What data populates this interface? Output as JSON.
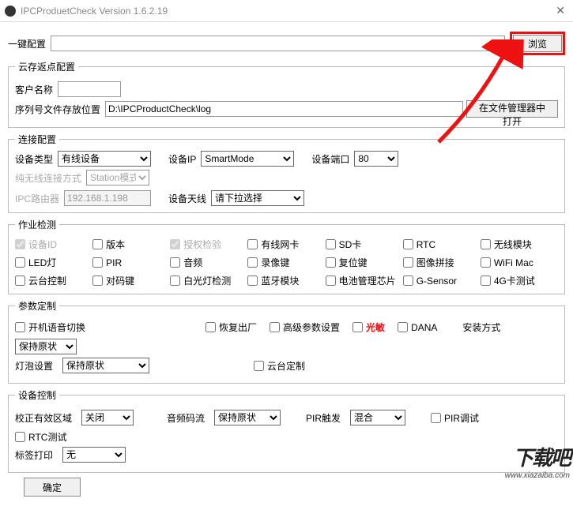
{
  "window": {
    "title": "IPCProduetCheck Version 1.6.2.19"
  },
  "oneKey": {
    "label": "一键配置",
    "value": "",
    "browse": "浏览"
  },
  "cloud": {
    "legend": "云存返点配置",
    "customerLabel": "客户名称",
    "customerValue": "",
    "snPathLabel": "序列号文件存放位置",
    "snPathValue": "D:\\IPCProductCheck\\log",
    "openInExplorer": "在文件管理器中打开"
  },
  "conn": {
    "legend": "连接配置",
    "deviceTypeLabel": "设备类型",
    "deviceType": "有线设备",
    "deviceIpLabel": "设备IP",
    "deviceIp": "SmartMode",
    "devicePortLabel": "设备端口",
    "devicePort": "80",
    "wifiModeLabel": "纯无线连接方式",
    "wifiMode": "Station模式",
    "ipcRouterLabel": "IPC路由器",
    "ipcRouter": "192.168.1.198",
    "antennaLabel": "设备天线",
    "antenna": "请下拉选择"
  },
  "job": {
    "legend": "作业检测",
    "items": [
      {
        "label": "设备ID",
        "checked": true,
        "disabled": true
      },
      {
        "label": "版本"
      },
      {
        "label": "授权检验",
        "checked": true,
        "disabled": true
      },
      {
        "label": "有线网卡"
      },
      {
        "label": "SD卡"
      },
      {
        "label": "RTC"
      },
      {
        "label": "无线模块"
      },
      {
        "label": "LED灯"
      },
      {
        "label": "PIR"
      },
      {
        "label": "音频"
      },
      {
        "label": "录像键"
      },
      {
        "label": "复位键"
      },
      {
        "label": "图像拼接"
      },
      {
        "label": "WiFi Mac"
      },
      {
        "label": "云台控制"
      },
      {
        "label": "对码键"
      },
      {
        "label": "白光灯检测"
      },
      {
        "label": "蓝牙模块"
      },
      {
        "label": "电池管理芯片"
      },
      {
        "label": "G-Sensor"
      },
      {
        "label": "4G卡测试"
      }
    ]
  },
  "params": {
    "legend": "参数定制",
    "bootVoice": "开机语音切换",
    "restore": "恢复出厂",
    "advParam": "高级参数设置",
    "light": "光敏",
    "dana": "DANA",
    "installModeLabel": "安装方式",
    "installMode": "保持原状",
    "bulbLabel": "灯泡设置",
    "bulb": "保持原状",
    "ptzCustom": "云台定制"
  },
  "devctrl": {
    "legend": "设备控制",
    "calibAreaLabel": "校正有效区域",
    "calibArea": "关闭",
    "bitrateLabel": "音频码流",
    "bitrate": "保持原状",
    "pirTrigLabel": "PIR触发",
    "pirTrig": "混合",
    "pirDebug": "PIR调试",
    "rtcTest": "RTC测试",
    "labelPrintLabel": "标签打印",
    "labelPrint": "无"
  },
  "ok": "确定",
  "watermark": {
    "big": "下载吧",
    "url": "www.xiazaiba.com"
  }
}
